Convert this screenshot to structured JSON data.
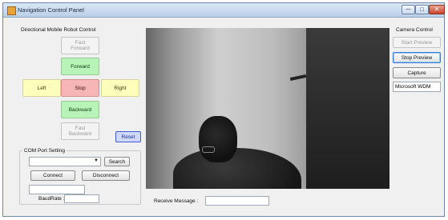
{
  "window": {
    "title": "Navigation Control Panel",
    "controls": {
      "minimize": "─",
      "maximize": "□",
      "close": "✕"
    }
  },
  "robot_control": {
    "title": "Directional Mobile Robot Control",
    "fast_forward": "Fast\nForward",
    "forward": "Forward",
    "left": "Left",
    "stop": "Stop",
    "right": "Right",
    "backward": "Backward",
    "fast_backward": "Fast\nBackward",
    "reset": "Reset"
  },
  "com_port": {
    "title": "COM Port Setting",
    "port_value": "",
    "search": "Search",
    "connect": "Connect",
    "disconnect": "Disconnect",
    "extra_field_value": "",
    "baudrate_label": "BaudRate :",
    "baudrate_value": ""
  },
  "camera": {
    "title": "Camera Control",
    "start_preview": "Start Preview",
    "stop_preview": "Stop Preview",
    "capture": "Capture",
    "device": "Microsoft WDM"
  },
  "receive": {
    "label": "Receive Message :",
    "value": ""
  },
  "colors": {
    "green_button": "#b8f4b8",
    "red_button": "#f7b6b6",
    "yellow_button": "#fdfdbc",
    "reset_button": "#cfd8f8"
  }
}
